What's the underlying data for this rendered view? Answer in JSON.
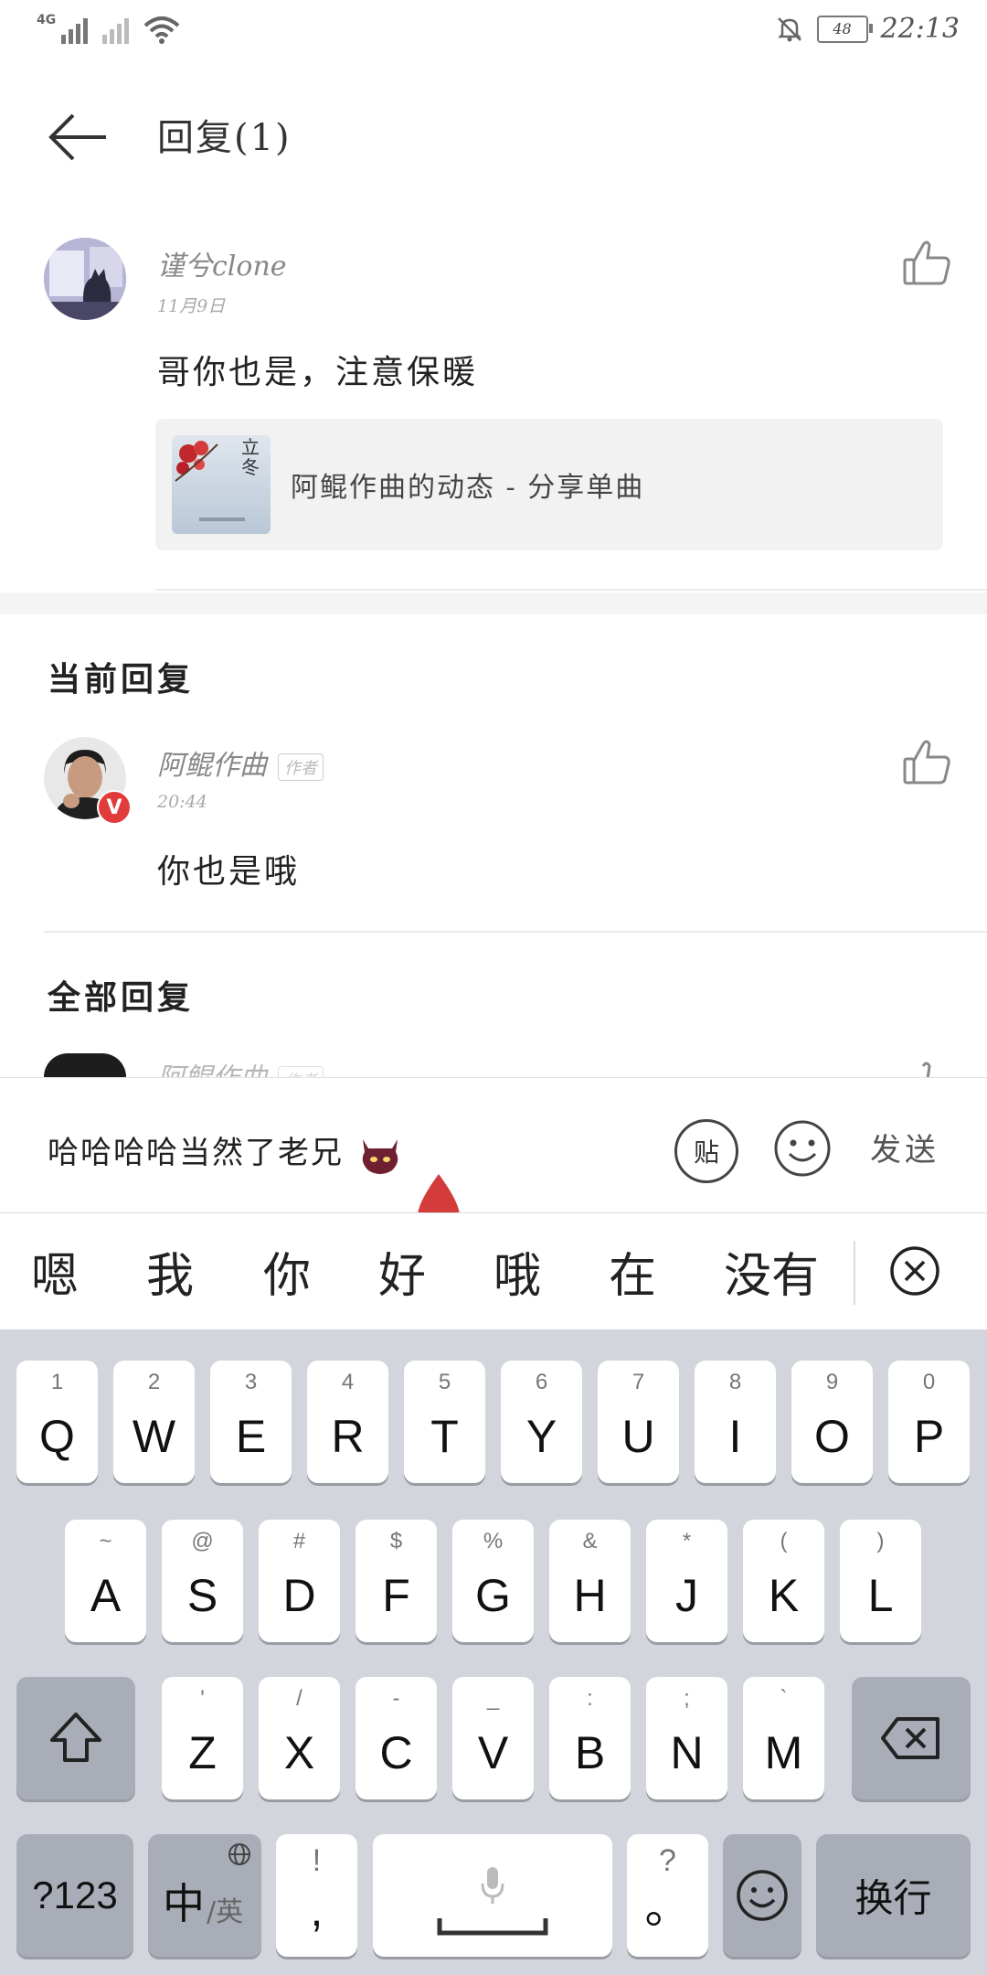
{
  "status_bar": {
    "network": "4G",
    "battery": "48",
    "time": "22:13"
  },
  "header": {
    "title": "回复(1)"
  },
  "original_comment": {
    "username": "谨兮clone",
    "date": "11月9日",
    "text": "哥你也是，注意保暖",
    "share_card": {
      "thumb_text": "立冬",
      "text": "阿鲲作曲的动态 - 分享单曲"
    }
  },
  "current_reply": {
    "section_title": "当前回复",
    "username": "阿鲲作曲",
    "author_tag": "作者",
    "verified_badge": "V",
    "time": "20:44",
    "text": "你也是哦"
  },
  "all_replies": {
    "section_title": "全部回复",
    "partial_username": "阿鲲作曲",
    "partial_tag": "作者"
  },
  "input_bar": {
    "text": "哈哈哈哈当然了老兄",
    "tie_label": "贴",
    "send_label": "发送"
  },
  "candidates": [
    "嗯",
    "我",
    "你",
    "好",
    "哦",
    "在",
    "没有"
  ],
  "keyboard": {
    "row1": [
      {
        "main": "Q",
        "sub": "1"
      },
      {
        "main": "W",
        "sub": "2"
      },
      {
        "main": "E",
        "sub": "3"
      },
      {
        "main": "R",
        "sub": "4"
      },
      {
        "main": "T",
        "sub": "5"
      },
      {
        "main": "Y",
        "sub": "6"
      },
      {
        "main": "U",
        "sub": "7"
      },
      {
        "main": "I",
        "sub": "8"
      },
      {
        "main": "O",
        "sub": "9"
      },
      {
        "main": "P",
        "sub": "0"
      }
    ],
    "row2": [
      {
        "main": "A",
        "sub": "~"
      },
      {
        "main": "S",
        "sub": "@"
      },
      {
        "main": "D",
        "sub": "#"
      },
      {
        "main": "F",
        "sub": "$"
      },
      {
        "main": "G",
        "sub": "%"
      },
      {
        "main": "H",
        "sub": "&"
      },
      {
        "main": "J",
        "sub": "*"
      },
      {
        "main": "K",
        "sub": "("
      },
      {
        "main": "L",
        "sub": ")"
      }
    ],
    "row3": [
      {
        "main": "Z",
        "sub": "'"
      },
      {
        "main": "X",
        "sub": "/"
      },
      {
        "main": "C",
        "sub": "-"
      },
      {
        "main": "V",
        "sub": "_"
      },
      {
        "main": "B",
        "sub": ":"
      },
      {
        "main": "N",
        "sub": ";"
      },
      {
        "main": "M",
        "sub": "`"
      }
    ],
    "num_key": "?123",
    "lang_key_main": "中",
    "lang_key_sub": "/英",
    "comma_key_sub": "!",
    "comma_key": ",",
    "period_key_sub": "?",
    "period_key": "。",
    "enter_key": "换行"
  }
}
